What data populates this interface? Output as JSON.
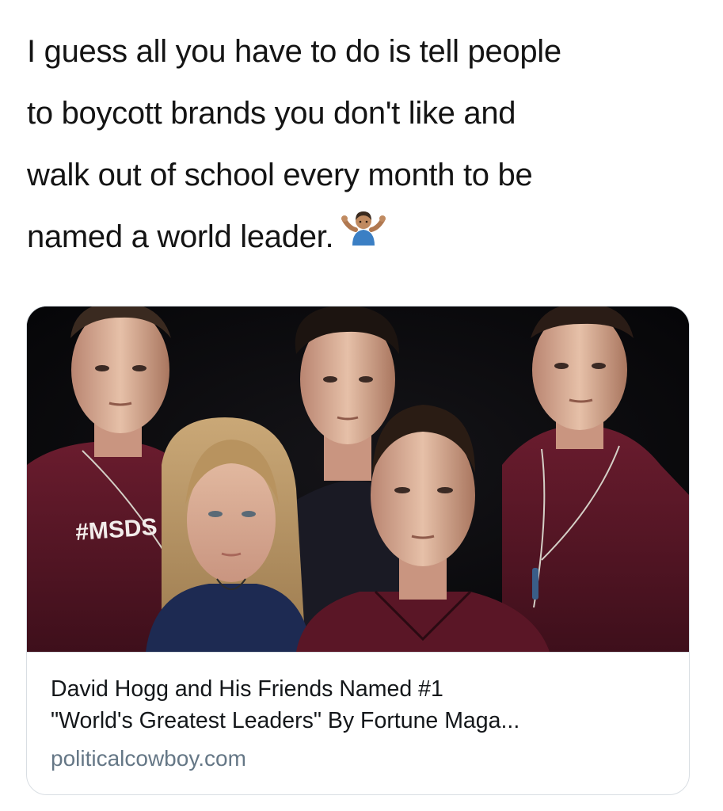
{
  "tweet": {
    "lines": [
      "I guess all you have to do is tell people",
      "to boycott brands you don't like and",
      "walk out of school every month to be",
      "named a world leader."
    ],
    "emoji": "person-shrugging-emoji"
  },
  "link_card": {
    "image_icon": "group-portrait-photo",
    "shirt_text": "#MSDS",
    "title_line_1": "David Hogg and His Friends Named #1",
    "title_line_2": "\"World's Greatest Leaders\" By Fortune Maga...",
    "domain": "politicalcowboy.com"
  },
  "colors": {
    "text": "#141414",
    "card_border": "#d9dee3",
    "domain_text": "#657786",
    "photo_background": "#07070a",
    "shirt_maroon": "#5a1626"
  }
}
